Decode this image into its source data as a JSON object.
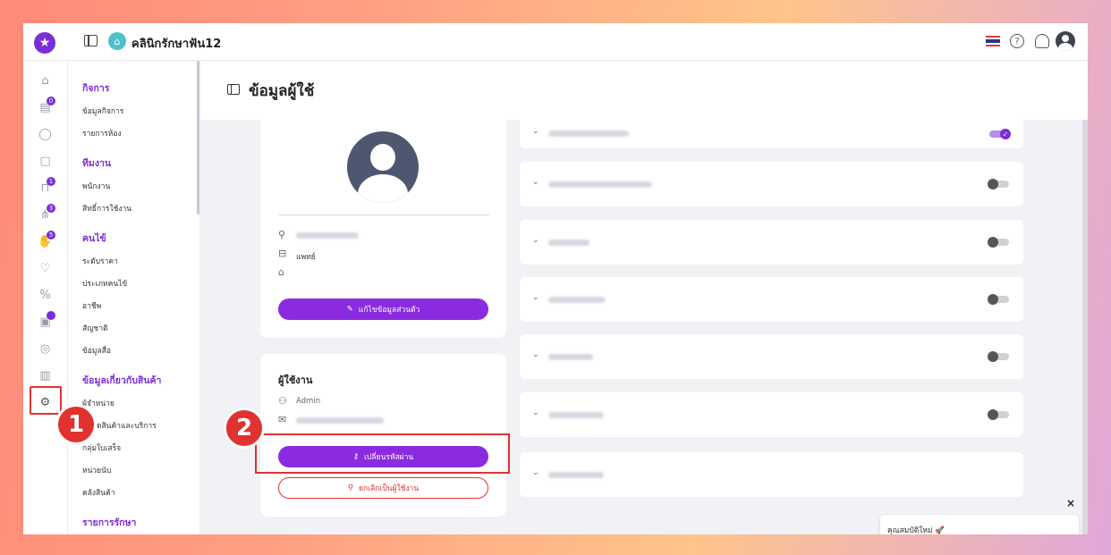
{
  "header": {
    "clinic_name": "คลินิกรักษาฟัน12"
  },
  "rail": {
    "badges": [
      "0",
      "1",
      "3",
      "5"
    ]
  },
  "menu": {
    "sections": [
      {
        "title": "กิจการ",
        "items": [
          "ข้อมูลกิจการ",
          "รายการห้อง"
        ]
      },
      {
        "title": "ทีมงาน",
        "items": [
          "พนักงาน",
          "สิทธิ์การใช้งาน"
        ]
      },
      {
        "title": "คนไข้",
        "items": [
          "ระดับราคา",
          "ประเภทคนไข้",
          "อาชีพ",
          "สัญชาติ",
          "ข้อมูลสื่อ"
        ]
      },
      {
        "title": "ข้อมูลเกี่ยวกับสินค้า",
        "items": [
          "ผู้จำหน่าย",
          "หมวดสินค้าและบริการ",
          "กลุ่มใบเสร็จ",
          "หน่วยนับ",
          "คลังสินค้า"
        ]
      },
      {
        "title": "รายการรักษา",
        "items": []
      }
    ]
  },
  "page": {
    "title": "ข้อมูลผู้ใช้"
  },
  "profile": {
    "position": "แพทย์",
    "edit_button": "แก้ไขข้อมูลส่วนตัว"
  },
  "user_card": {
    "title": "ผู้ใช้งาน",
    "role": "Admin",
    "change_password_button": "เปลี่ยนรหัสผ่าน",
    "cancel_user_button": "ยกเลิกเป็นผู้ใช้งาน"
  },
  "permissions": {
    "rows": [
      {
        "enabled": true
      },
      {
        "enabled": false
      },
      {
        "enabled": false
      },
      {
        "enabled": false
      },
      {
        "enabled": false
      },
      {
        "enabled": false
      },
      {
        "enabled": false
      }
    ]
  },
  "annotations": {
    "step1": "1",
    "step2": "2"
  },
  "popup": {
    "text": "คุณสมบัติใหม่ 🚀",
    "close": "×"
  },
  "colors": {
    "accent": "#7b2ed8",
    "button": "#8a2be2",
    "danger": "#e0322f"
  }
}
